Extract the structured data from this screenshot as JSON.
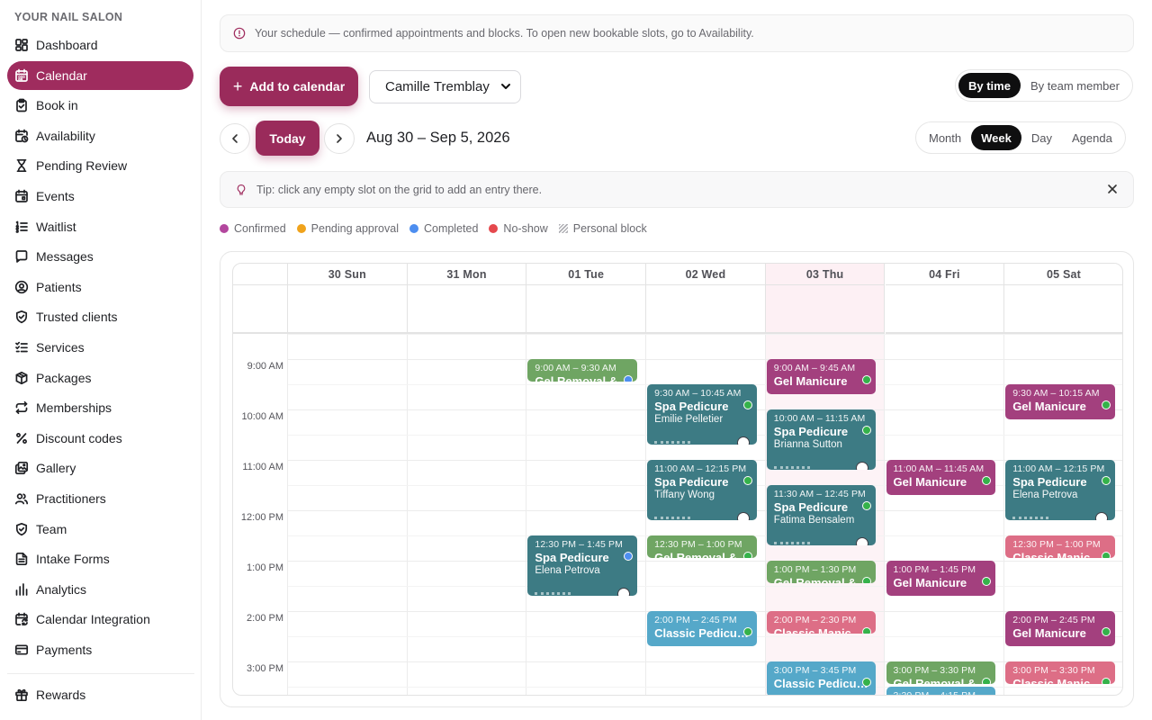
{
  "brand": "YOUR NAIL SALON",
  "nav": [
    {
      "label": "Dashboard",
      "icon": "dashboard-icon",
      "active": false
    },
    {
      "label": "Calendar",
      "icon": "calendar-icon",
      "active": true
    },
    {
      "label": "Book in",
      "icon": "clipboard-icon",
      "active": false
    },
    {
      "label": "Availability",
      "icon": "calendar-clock-icon",
      "active": false
    },
    {
      "label": "Pending Review",
      "icon": "hourglass-icon",
      "active": false
    },
    {
      "label": "Events",
      "icon": "calendar-event-icon",
      "active": false
    },
    {
      "label": "Waitlist",
      "icon": "list-ordered-icon",
      "active": false
    },
    {
      "label": "Messages",
      "icon": "message-icon",
      "active": false
    },
    {
      "label": "Patients",
      "icon": "user-circle-icon",
      "active": false
    },
    {
      "label": "Trusted clients",
      "icon": "shield-check-icon",
      "active": false
    },
    {
      "label": "Services",
      "icon": "list-check-icon",
      "active": false
    },
    {
      "label": "Packages",
      "icon": "package-icon",
      "active": false
    },
    {
      "label": "Memberships",
      "icon": "repeat-icon",
      "active": false
    },
    {
      "label": "Discount codes",
      "icon": "percent-icon",
      "active": false
    },
    {
      "label": "Gallery",
      "icon": "gallery-icon",
      "active": false
    },
    {
      "label": "Practitioners",
      "icon": "users-icon",
      "active": false
    },
    {
      "label": "Team",
      "icon": "shield-icon",
      "active": false
    },
    {
      "label": "Intake Forms",
      "icon": "document-icon",
      "active": false
    },
    {
      "label": "Analytics",
      "icon": "bar-chart-icon",
      "active": false
    },
    {
      "label": "Calendar Integration",
      "icon": "calendar-sync-icon",
      "active": false
    },
    {
      "label": "Payments",
      "icon": "credit-card-icon",
      "active": false
    }
  ],
  "nav_extra": [
    {
      "label": "Rewards",
      "icon": "gift-icon"
    }
  ],
  "banner": "Your schedule — confirmed appointments and blocks. To open new bookable slots, go to Availability.",
  "toolbar": {
    "add_label": "Add to calendar",
    "member_select": "Camille Tremblay",
    "view_mode": [
      "By time",
      "By team member"
    ],
    "view_mode_active": "By time",
    "today_label": "Today",
    "range": "Aug 30 – Sep 5, 2026",
    "ranges": [
      "Month",
      "Week",
      "Day",
      "Agenda"
    ],
    "range_active": "Week"
  },
  "tip": "Tip: click any empty slot on the grid to add an entry there.",
  "legend": [
    {
      "label": "Confirmed",
      "color": "#b3479e",
      "kind": "dot"
    },
    {
      "label": "Pending approval",
      "color": "#f0a31c",
      "kind": "dot"
    },
    {
      "label": "Completed",
      "color": "#4d8ef0",
      "kind": "dot"
    },
    {
      "label": "No-show",
      "color": "#e5484d",
      "kind": "dot"
    },
    {
      "label": "Personal block",
      "color": "#b0b0b5",
      "kind": "hatch"
    }
  ],
  "days": [
    "30 Sun",
    "31 Mon",
    "01 Tue",
    "02 Wed",
    "03 Thu",
    "04 Fri",
    "05 Sat"
  ],
  "today_index": 4,
  "time_labels": [
    "9:00 AM",
    "10:00 AM",
    "11:00 AM",
    "12:00 PM",
    "1:00 PM",
    "2:00 PM",
    "3:00 PM"
  ],
  "colors": {
    "teal": "#3d7b84",
    "magenta": "#a3407e",
    "green": "#6fa563",
    "blue": "#55a8c9",
    "pink": "#dd6e86",
    "accent": "#9a2b5b"
  },
  "events": [
    {
      "day": 2,
      "start": "9:00",
      "end": "9:30",
      "time": "9:00 AM – 9:30 AM",
      "title": "Gel Removal &",
      "client": "",
      "color": "green",
      "status": "#4d8ef0"
    },
    {
      "day": 2,
      "start": "12:30",
      "end": "13:45",
      "time": "12:30 PM – 1:45 PM",
      "title": "Spa Pedicure",
      "client": "Elena Petrova",
      "color": "teal",
      "status": "#4d8ef0"
    },
    {
      "day": 3,
      "start": "9:30",
      "end": "10:45",
      "time": "9:30 AM – 10:45 AM",
      "title": "Spa Pedicure",
      "client": "Emilie Pelletier",
      "color": "teal",
      "status": "#35b24a"
    },
    {
      "day": 3,
      "start": "11:00",
      "end": "12:15",
      "time": "11:00 AM – 12:15 PM",
      "title": "Spa Pedicure",
      "client": "Tiffany Wong",
      "color": "teal",
      "status": "#35b24a"
    },
    {
      "day": 3,
      "start": "12:30",
      "end": "13:00",
      "time": "12:30 PM – 1:00 PM",
      "title": "Gel Removal &",
      "client": "",
      "color": "green",
      "status": "#35b24a"
    },
    {
      "day": 3,
      "start": "14:00",
      "end": "14:45",
      "time": "2:00 PM – 2:45 PM",
      "title": "Classic Pedicu…",
      "client": "",
      "color": "blue",
      "status": "#35b24a"
    },
    {
      "day": 4,
      "start": "9:00",
      "end": "9:45",
      "time": "9:00 AM – 9:45 AM",
      "title": "Gel Manicure",
      "client": "",
      "color": "magenta",
      "status": "#35b24a"
    },
    {
      "day": 4,
      "start": "10:00",
      "end": "11:15",
      "time": "10:00 AM – 11:15 AM",
      "title": "Spa Pedicure",
      "client": "Brianna Sutton",
      "color": "teal",
      "status": "#35b24a"
    },
    {
      "day": 4,
      "start": "11:30",
      "end": "12:45",
      "time": "11:30 AM – 12:45 PM",
      "title": "Spa Pedicure",
      "client": "Fatima Bensalem",
      "color": "teal",
      "status": "#35b24a"
    },
    {
      "day": 4,
      "start": "13:00",
      "end": "13:30",
      "time": "1:00 PM – 1:30 PM",
      "title": "Gel Removal &",
      "client": "",
      "color": "green",
      "status": "#35b24a"
    },
    {
      "day": 4,
      "start": "14:00",
      "end": "14:30",
      "time": "2:00 PM – 2:30 PM",
      "title": "Classic Manic…",
      "client": "",
      "color": "pink",
      "status": "#35b24a"
    },
    {
      "day": 4,
      "start": "15:00",
      "end": "15:45",
      "time": "3:00 PM – 3:45 PM",
      "title": "Classic Pedicu…",
      "client": "",
      "color": "blue",
      "status": "#35b24a"
    },
    {
      "day": 5,
      "start": "11:00",
      "end": "11:45",
      "time": "11:00 AM – 11:45 AM",
      "title": "Gel Manicure",
      "client": "",
      "color": "magenta",
      "status": "#35b24a"
    },
    {
      "day": 5,
      "start": "13:00",
      "end": "13:45",
      "time": "1:00 PM – 1:45 PM",
      "title": "Gel Manicure",
      "client": "",
      "color": "magenta",
      "status": "#35b24a"
    },
    {
      "day": 5,
      "start": "15:00",
      "end": "15:30",
      "time": "3:00 PM – 3:30 PM",
      "title": "Gel Removal &",
      "client": "",
      "color": "green",
      "status": "#35b24a"
    },
    {
      "day": 5,
      "start": "15:30",
      "end": "16:15",
      "time": "3:30 PM – 4:15 PM",
      "title": "",
      "client": "",
      "color": "blue",
      "status": ""
    },
    {
      "day": 6,
      "start": "9:30",
      "end": "10:15",
      "time": "9:30 AM – 10:15 AM",
      "title": "Gel Manicure",
      "client": "",
      "color": "magenta",
      "status": "#35b24a"
    },
    {
      "day": 6,
      "start": "11:00",
      "end": "12:15",
      "time": "11:00 AM – 12:15 PM",
      "title": "Spa Pedicure",
      "client": "Elena Petrova",
      "color": "teal",
      "status": "#35b24a"
    },
    {
      "day": 6,
      "start": "12:30",
      "end": "13:00",
      "time": "12:30 PM – 1:00 PM",
      "title": "Classic Manic…",
      "client": "",
      "color": "pink",
      "status": "#35b24a"
    },
    {
      "day": 6,
      "start": "14:00",
      "end": "14:45",
      "time": "2:00 PM – 2:45 PM",
      "title": "Gel Manicure",
      "client": "",
      "color": "magenta",
      "status": "#35b24a"
    },
    {
      "day": 6,
      "start": "15:00",
      "end": "15:30",
      "time": "3:00 PM – 3:30 PM",
      "title": "Classic Manic…",
      "client": "",
      "color": "pink",
      "status": "#35b24a"
    }
  ]
}
